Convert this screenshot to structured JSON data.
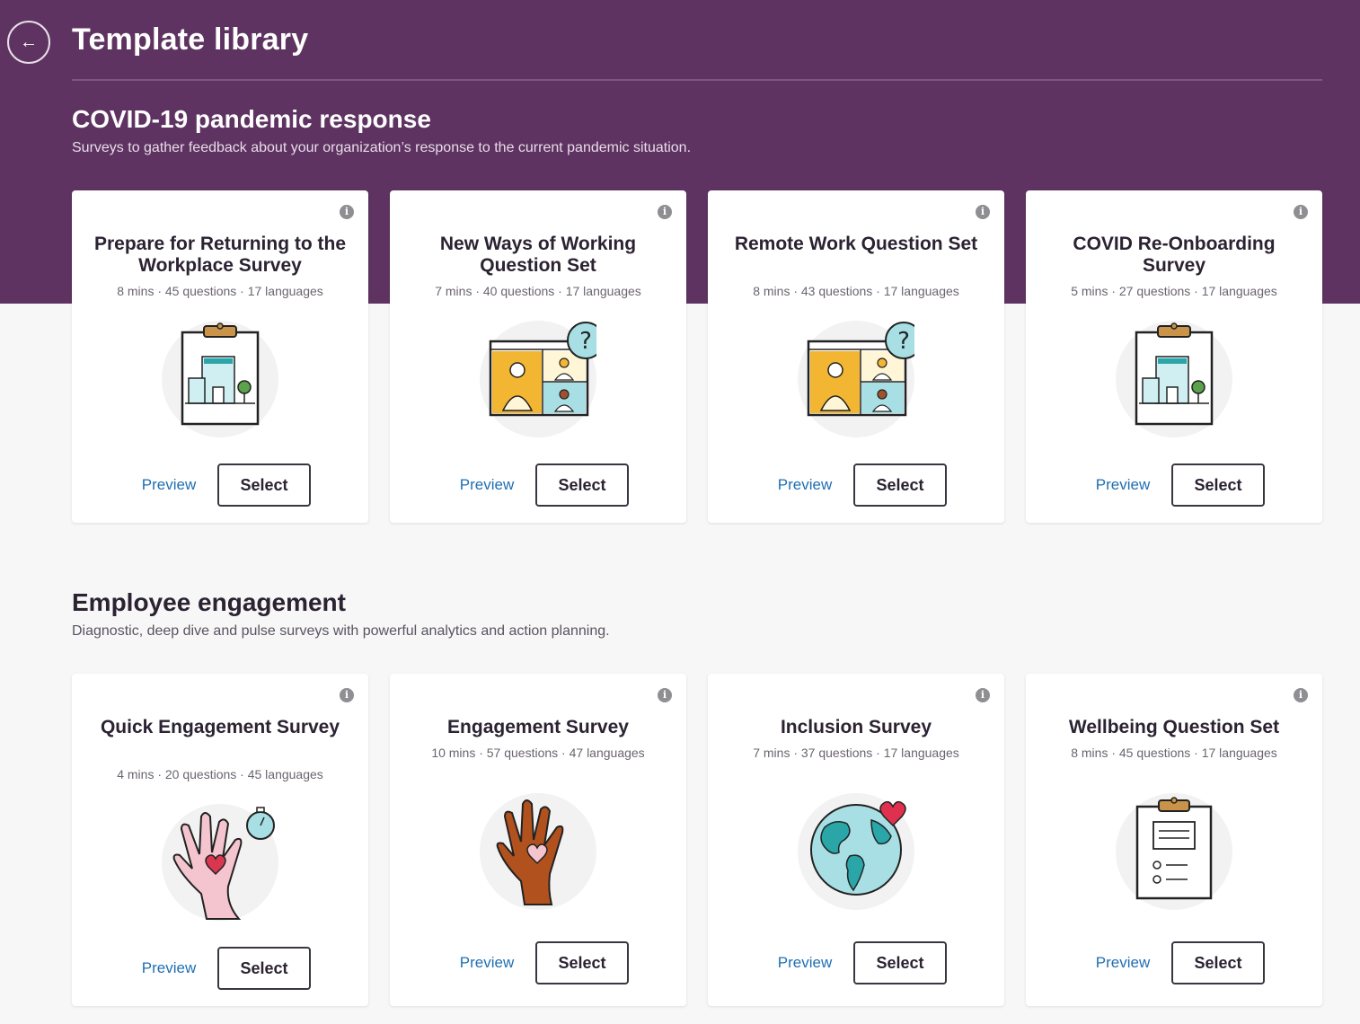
{
  "header": {
    "title": "Template library",
    "back_icon": "arrow-left-icon"
  },
  "labels": {
    "preview": "Preview",
    "select": "Select",
    "info_icon": "info-icon"
  },
  "colors": {
    "header_bg": "#5e3361",
    "link": "#1f6fb2"
  },
  "sections": [
    {
      "title": "COVID-19 pandemic response",
      "description": "Surveys to gather feedback about your organization’s response to the current pandemic situation.",
      "cards": [
        {
          "title": "Prepare for Returning to the Workplace Survey",
          "meta": "8 mins · 45 questions · 17 languages",
          "illustration": "clipboard-building-icon"
        },
        {
          "title": "New Ways of Working Question Set",
          "meta": "7 mins · 40 questions · 17 languages",
          "illustration": "video-call-question-icon"
        },
        {
          "title": "Remote Work Question Set",
          "meta": "8 mins · 43 questions · 17 languages",
          "illustration": "video-call-question-icon"
        },
        {
          "title": "COVID Re-Onboarding Survey",
          "meta": "5 mins · 27 questions · 17 languages",
          "illustration": "clipboard-building-icon"
        }
      ]
    },
    {
      "title": "Employee engagement",
      "description": "Diagnostic, deep dive and pulse surveys with powerful analytics and action planning.",
      "cards": [
        {
          "title": "Quick Engagement Survey",
          "meta": "4 mins · 20 questions · 45 languages",
          "illustration": "hand-heart-stopwatch-icon"
        },
        {
          "title": "Engagement Survey",
          "meta": "10 mins · 57 questions · 47 languages",
          "illustration": "hand-heart-icon"
        },
        {
          "title": "Inclusion Survey",
          "meta": "7 mins · 37 questions · 17 languages",
          "illustration": "globe-heart-icon"
        },
        {
          "title": "Wellbeing Question Set",
          "meta": "8 mins · 45 questions · 17 languages",
          "illustration": "clipboard-checklist-icon"
        }
      ]
    }
  ]
}
